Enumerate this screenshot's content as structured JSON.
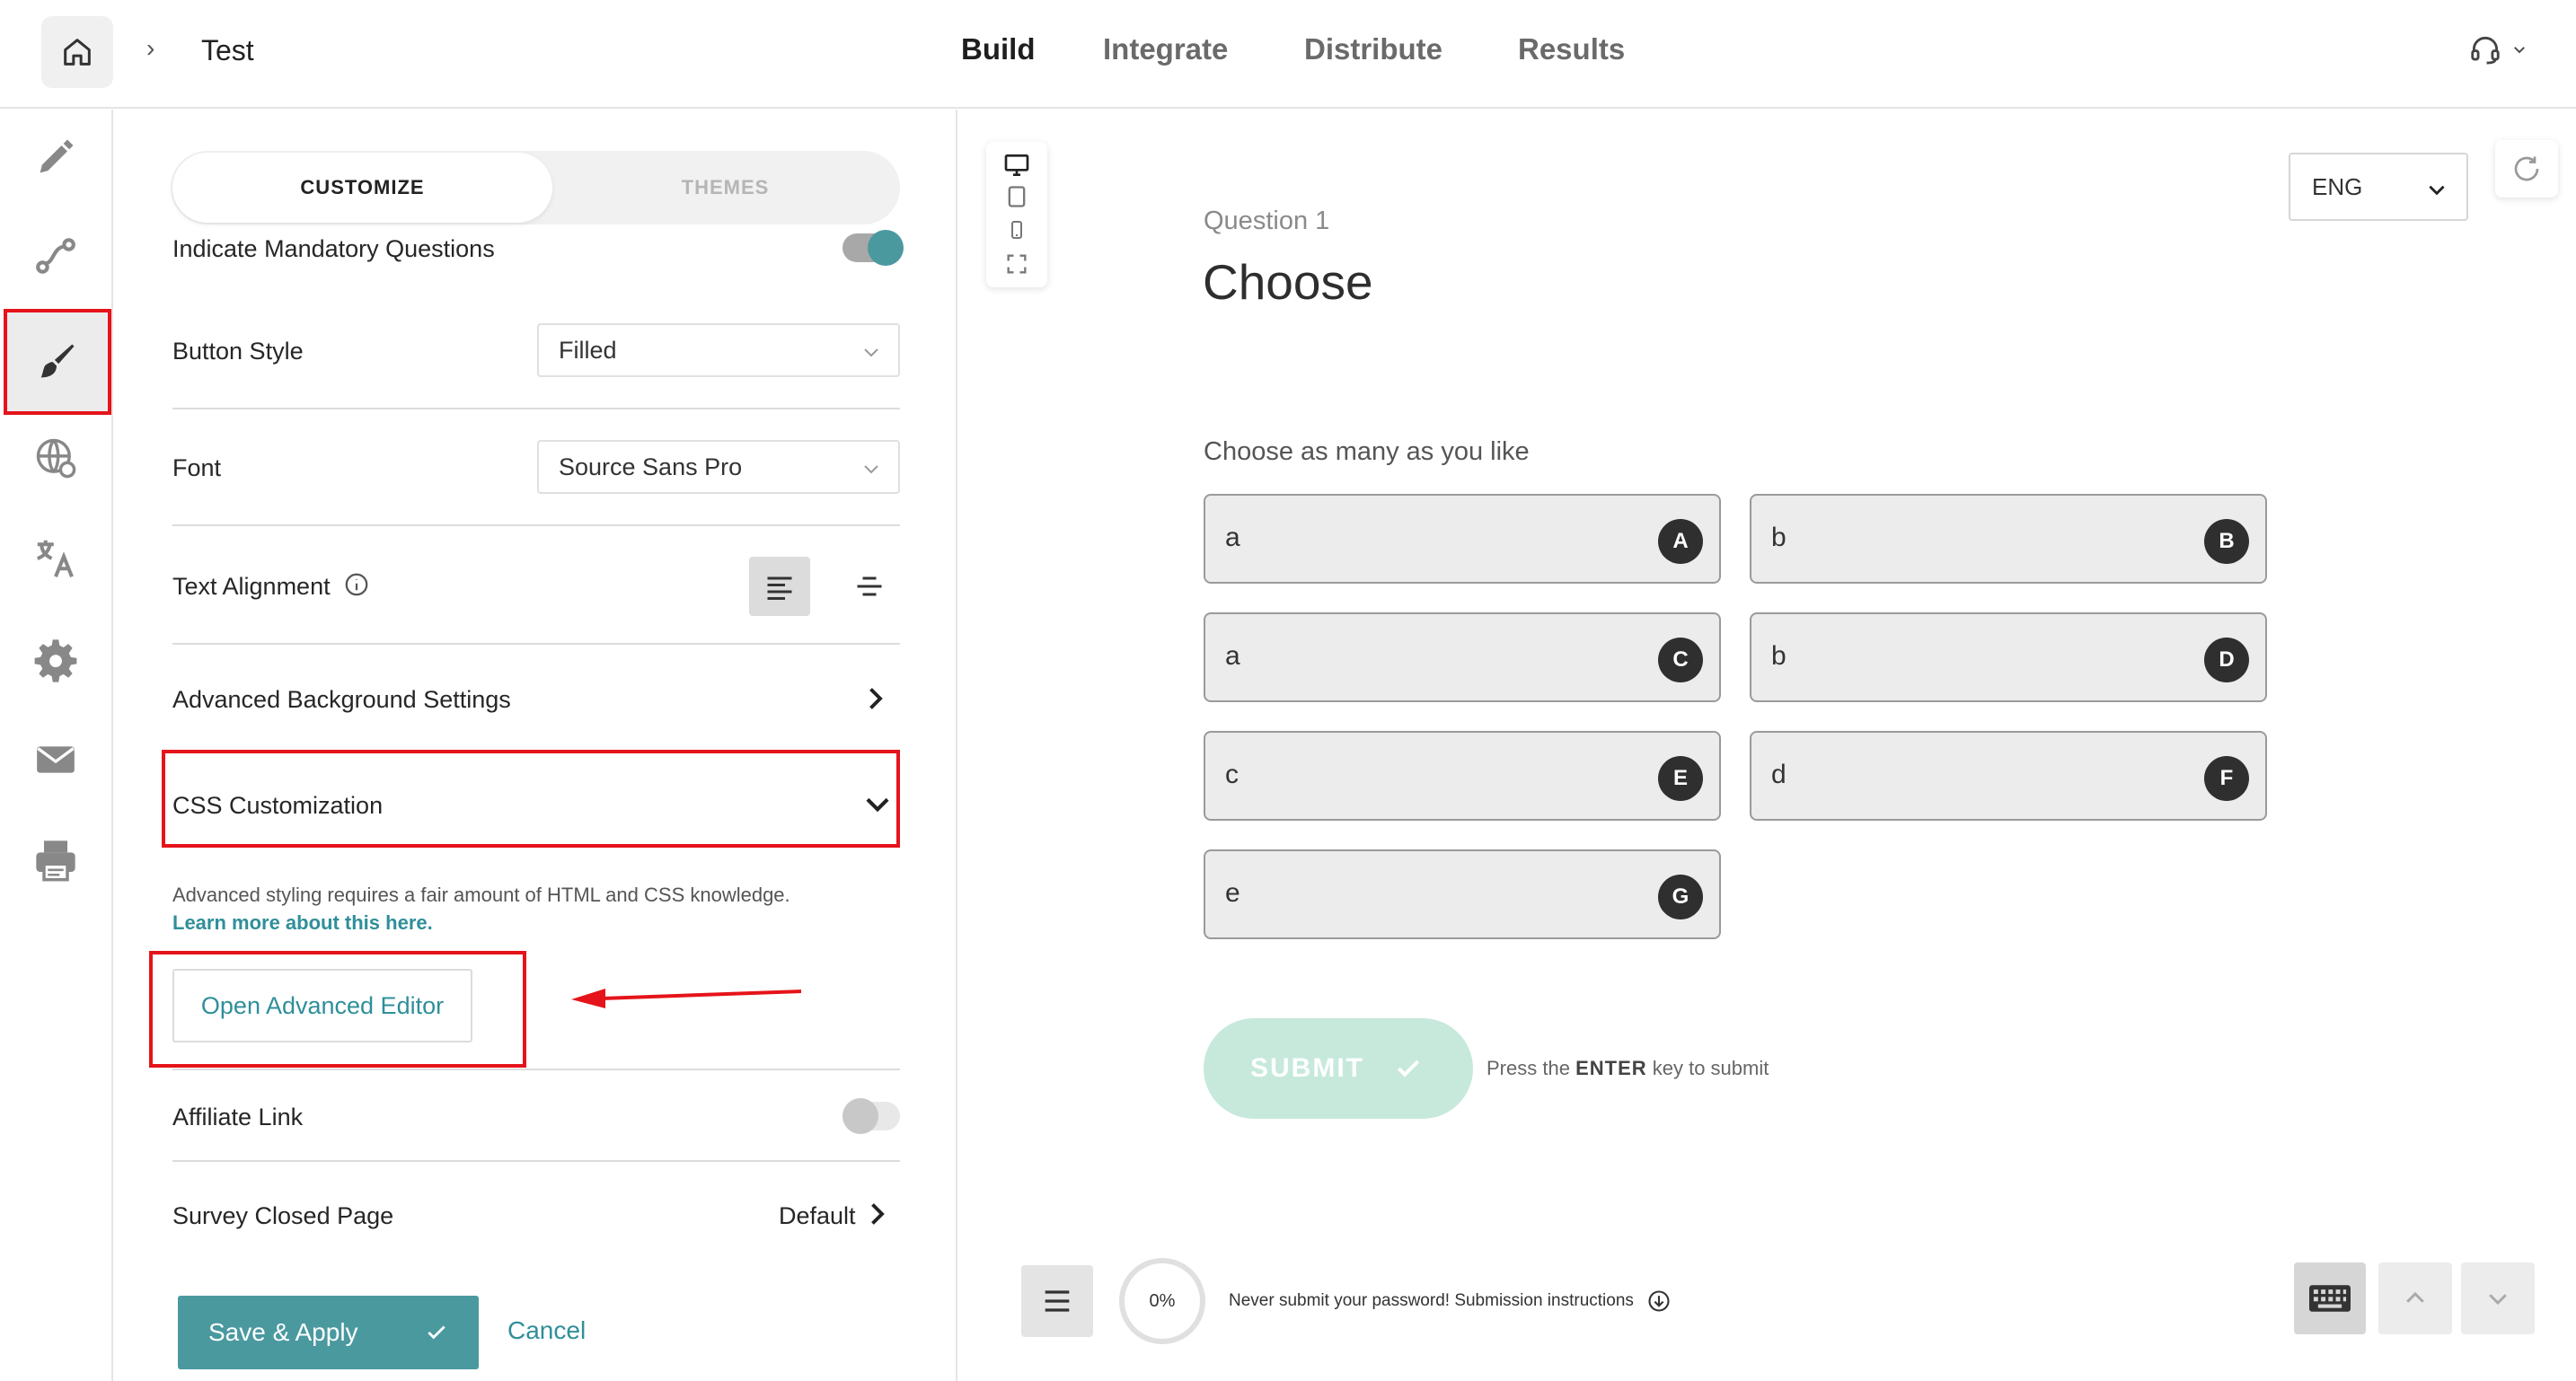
{
  "header": {
    "breadcrumb_separator": "›",
    "survey_title": "Test",
    "tabs": [
      {
        "label": "Build",
        "active": true
      },
      {
        "label": "Integrate",
        "active": false
      },
      {
        "label": "Distribute",
        "active": false
      },
      {
        "label": "Results",
        "active": false
      }
    ]
  },
  "rail": {
    "items": [
      {
        "icon": "pen-icon",
        "active": false
      },
      {
        "icon": "logic-flow-icon",
        "active": false
      },
      {
        "icon": "paintbrush-icon",
        "active": true
      },
      {
        "icon": "globe-icon",
        "active": false
      },
      {
        "icon": "translate-icon",
        "active": false
      },
      {
        "icon": "gear-icon",
        "active": false
      },
      {
        "icon": "envelope-icon",
        "active": false
      },
      {
        "icon": "printer-icon",
        "active": false
      }
    ]
  },
  "panel": {
    "segment": {
      "customize": "CUSTOMIZE",
      "themes": "THEMES"
    },
    "mandatory": {
      "label": "Indicate Mandatory Questions",
      "enabled": true
    },
    "button_style": {
      "label": "Button Style",
      "value": "Filled"
    },
    "font": {
      "label": "Font",
      "value": "Source Sans Pro"
    },
    "text_alignment": {
      "label": "Text Alignment",
      "selected": "left"
    },
    "advanced_bg": {
      "label": "Advanced Background Settings"
    },
    "css": {
      "label": "CSS Customization",
      "help": "Advanced styling requires a fair amount of HTML and CSS knowledge.",
      "link": "Learn more about this here.",
      "open_editor": "Open Advanced Editor"
    },
    "affiliate": {
      "label": "Affiliate Link",
      "enabled": false
    },
    "closed_page": {
      "label": "Survey Closed Page",
      "value": "Default"
    },
    "save_label": "Save & Apply",
    "cancel_label": "Cancel"
  },
  "preview": {
    "language": "ENG",
    "question_number": "Question 1",
    "question_title": "Choose",
    "hint": "Choose as many as you like",
    "choices": [
      {
        "text": "a",
        "key": "A"
      },
      {
        "text": "b",
        "key": "B"
      },
      {
        "text": "a",
        "key": "C"
      },
      {
        "text": "b",
        "key": "D"
      },
      {
        "text": "c",
        "key": "E"
      },
      {
        "text": "d",
        "key": "F"
      },
      {
        "text": "e",
        "key": "G"
      }
    ],
    "submit_label": "SUBMIT",
    "submit_hint_pre": "Press the",
    "submit_hint_key": "ENTER",
    "submit_hint_post": "key to submit",
    "progress": "0%",
    "password_note": "Never submit your password! Submission instructions"
  },
  "colors": {
    "accent": "#4a999f",
    "annotation_red": "#e5141a",
    "submit_bg": "#c6e9dc"
  }
}
